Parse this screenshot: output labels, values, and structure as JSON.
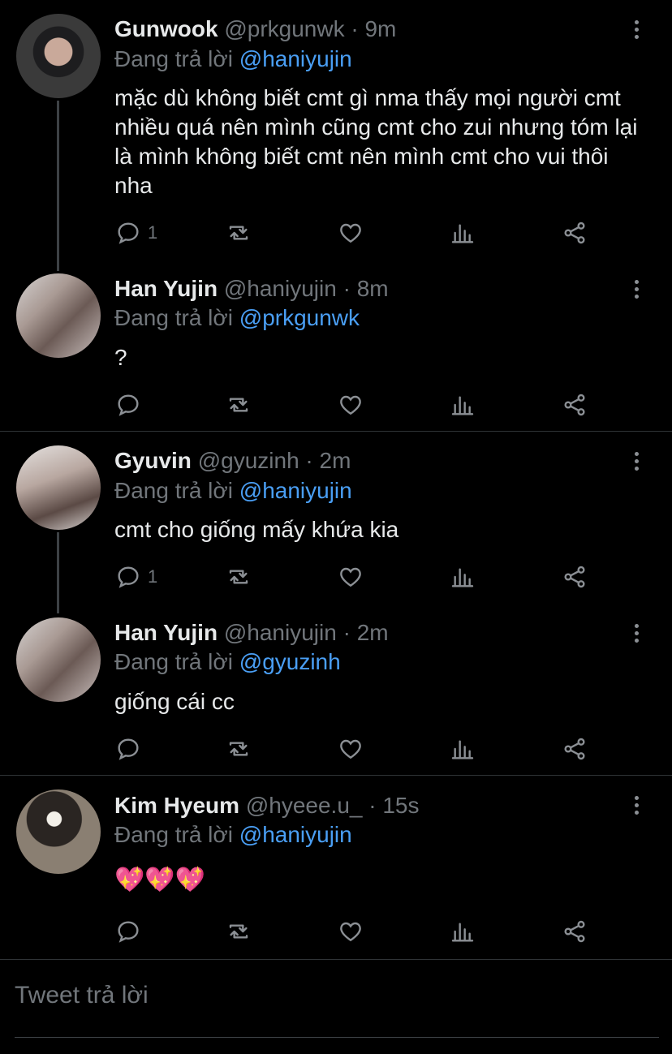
{
  "tweets": [
    {
      "name": "Gunwook",
      "handle": "@prkgunwk",
      "dot": "·",
      "time": "9m",
      "reply_prefix": "Đang trả lời",
      "reply_to": "@haniyujin",
      "text": "mặc dù không biết cmt gì nma thấy mọi người cmt nhiều quá nên mình cũng cmt cho zui nhưng tóm lại là mình không biết cmt nên mình cmt cho vui thôi nha",
      "reply_count": "1"
    },
    {
      "name": "Han Yujin",
      "handle": "@haniyujin",
      "dot": "·",
      "time": "8m",
      "reply_prefix": "Đang trả lời",
      "reply_to": "@prkgunwk",
      "text": "?",
      "reply_count": ""
    },
    {
      "name": "Gyuvin",
      "handle": "@gyuzinh",
      "dot": "·",
      "time": "2m",
      "reply_prefix": "Đang trả lời",
      "reply_to": "@haniyujin",
      "text": "cmt cho giống mấy khứa kia",
      "reply_count": "1"
    },
    {
      "name": "Han Yujin",
      "handle": "@haniyujin",
      "dot": "·",
      "time": "2m",
      "reply_prefix": "Đang trả lời",
      "reply_to": "@gyuzinh",
      "text": "giống cái cc",
      "reply_count": ""
    },
    {
      "name": "Kim Hyeum",
      "handle": "@hyeee.u_",
      "dot": "·",
      "time": "15s",
      "reply_prefix": "Đang trả lời",
      "reply_to": "@haniyujin",
      "text": "💖💖💖",
      "reply_count": ""
    }
  ],
  "reply_placeholder": "Tweet trả lời",
  "icons": {
    "reply": "reply-icon",
    "retweet": "retweet-icon",
    "like": "heart-icon",
    "analytics": "analytics-icon",
    "share": "share-icon",
    "more": "more-icon"
  },
  "colors": {
    "mention": "#4a9ff5",
    "muted": "#71767b",
    "background": "#000000"
  }
}
